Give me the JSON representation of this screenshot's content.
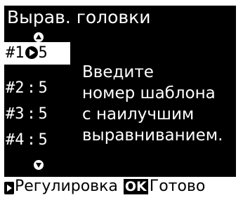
{
  "title": "Вырав. головки",
  "patterns": [
    {
      "label": "#1",
      "value": "5",
      "selected": true
    },
    {
      "label": "#2",
      "value": "5",
      "selected": false
    },
    {
      "label": "#3",
      "value": "5",
      "selected": false
    },
    {
      "label": "#4",
      "value": "5",
      "selected": false
    }
  ],
  "separator": ":",
  "message": {
    "line1": "Введите",
    "line2": "номер шаблона",
    "line3": "с наилучшим",
    "line4": "выравниванием."
  },
  "footer": {
    "adjust_label": "Регулировка",
    "ok_label": "OK",
    "done_label": "Готово"
  },
  "icons": {
    "up": "triangle-up-icon",
    "down": "triangle-down-icon",
    "select": "play-right-icon",
    "ok": "ok-button-icon"
  },
  "colors": {
    "screen_bg": "#000000",
    "screen_fg": "#ffffff",
    "highlight_bg": "#ffffff"
  }
}
